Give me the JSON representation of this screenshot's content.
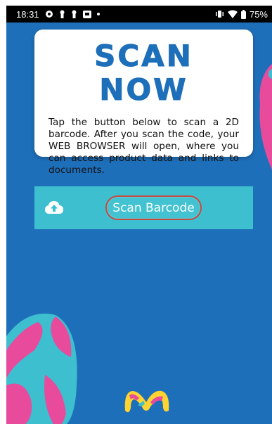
{
  "status_bar": {
    "time": "18:31",
    "battery": "75%",
    "icons": [
      "settings-icon",
      "keyhole-icon",
      "keyhole-icon",
      "sim-icon",
      "dot-icon",
      "vibrate-icon",
      "wifi-icon",
      "battery-icon"
    ]
  },
  "card": {
    "title": "SCAN NOW",
    "body": "Tap the button below to scan a 2D barcode. After you scan the code, your WEB BROWSER will open, where you can access product data and links to documents."
  },
  "scan_bar": {
    "button_label": "Scan Barcode",
    "icon": "cloud-upload-icon"
  },
  "colors": {
    "background": "#1e6fb9",
    "accent_teal": "#3dbfcf",
    "accent_pink": "#e84a9c",
    "button_border": "#c94a3c",
    "logo_yellow": "#ffd330"
  }
}
